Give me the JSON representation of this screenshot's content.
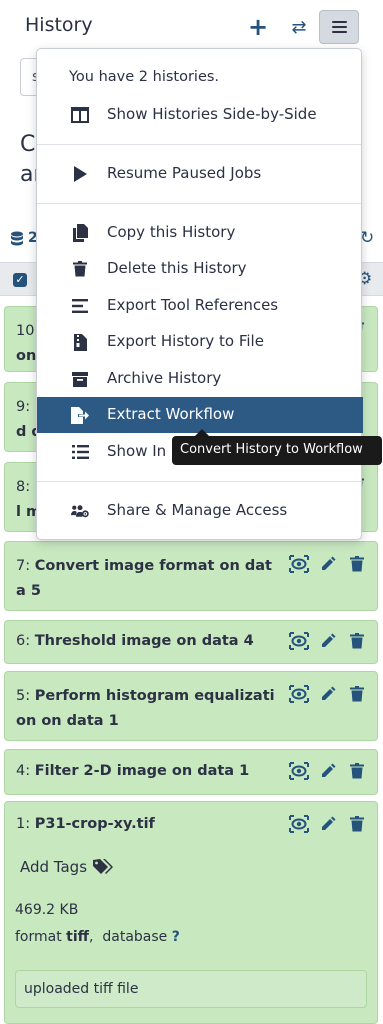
{
  "header": {
    "title": "History",
    "plus_icon": "plus-icon",
    "switch_icon": "exchange-icon",
    "menu_icon": "bars-icon"
  },
  "search": {
    "fragment": "s"
  },
  "history_name_fragment": {
    "line1": "C",
    "line2": "ar"
  },
  "stats": {
    "count_fragment": "2"
  },
  "datasets": [
    {
      "hid": "10",
      "name_fragment": "",
      "line2": "on",
      "state": "ok"
    },
    {
      "hid": "9",
      "name_fragment": "",
      "line2": "d d",
      "state": "ok"
    },
    {
      "hid": "8",
      "name_fragment": "",
      "line2": "l m",
      "state": "ok"
    },
    {
      "hid": "7",
      "name": "Convert image format on dat",
      "line2": "a 5",
      "state": "ok"
    },
    {
      "hid": "6",
      "name": "Threshold image on data 4",
      "line2": "",
      "state": "ok"
    },
    {
      "hid": "5",
      "name": "Perform histogram equalizati",
      "line2": "on on data 1",
      "state": "ok"
    },
    {
      "hid": "4",
      "name": "Filter 2-D image on data 1",
      "line2": "",
      "state": "ok"
    },
    {
      "hid": "1",
      "name": "P31-crop-xy.tif",
      "expanded": true,
      "add_tags": "Add Tags",
      "size": "469.2 KB",
      "format_label": "format",
      "format_value": "tiff",
      "database_label": "database",
      "database_value": "?",
      "info": "uploaded tiff file"
    }
  ],
  "dropdown": {
    "header": "You have 2 histories.",
    "items": [
      {
        "label": "Show Histories Side-by-Side",
        "icon": "columns-icon"
      },
      {
        "label": "Resume Paused Jobs",
        "icon": "play-icon"
      },
      {
        "label": "Copy this History",
        "icon": "copy-icon"
      },
      {
        "label": "Delete this History",
        "icon": "trash-icon"
      },
      {
        "label": "Export Tool References",
        "icon": "align-left-icon"
      },
      {
        "label": "Export History to File",
        "icon": "file-archive-icon"
      },
      {
        "label": "Archive History",
        "icon": "archive-icon"
      },
      {
        "label": "Extract Workflow",
        "icon": "file-export-icon",
        "active": true
      },
      {
        "label": "Show Invocations",
        "visible_fragment": "Show In",
        "icon": "list-icon"
      },
      {
        "label": "Share & Manage Access",
        "icon": "users-cog-icon"
      }
    ]
  },
  "tooltip": {
    "text": "Convert History to Workflow"
  },
  "colors": {
    "accent": "#25537b",
    "active_item": "#2c5a84",
    "dataset_ok_bg": "#c8e8c0",
    "dataset_ok_border": "#aed6a3"
  }
}
